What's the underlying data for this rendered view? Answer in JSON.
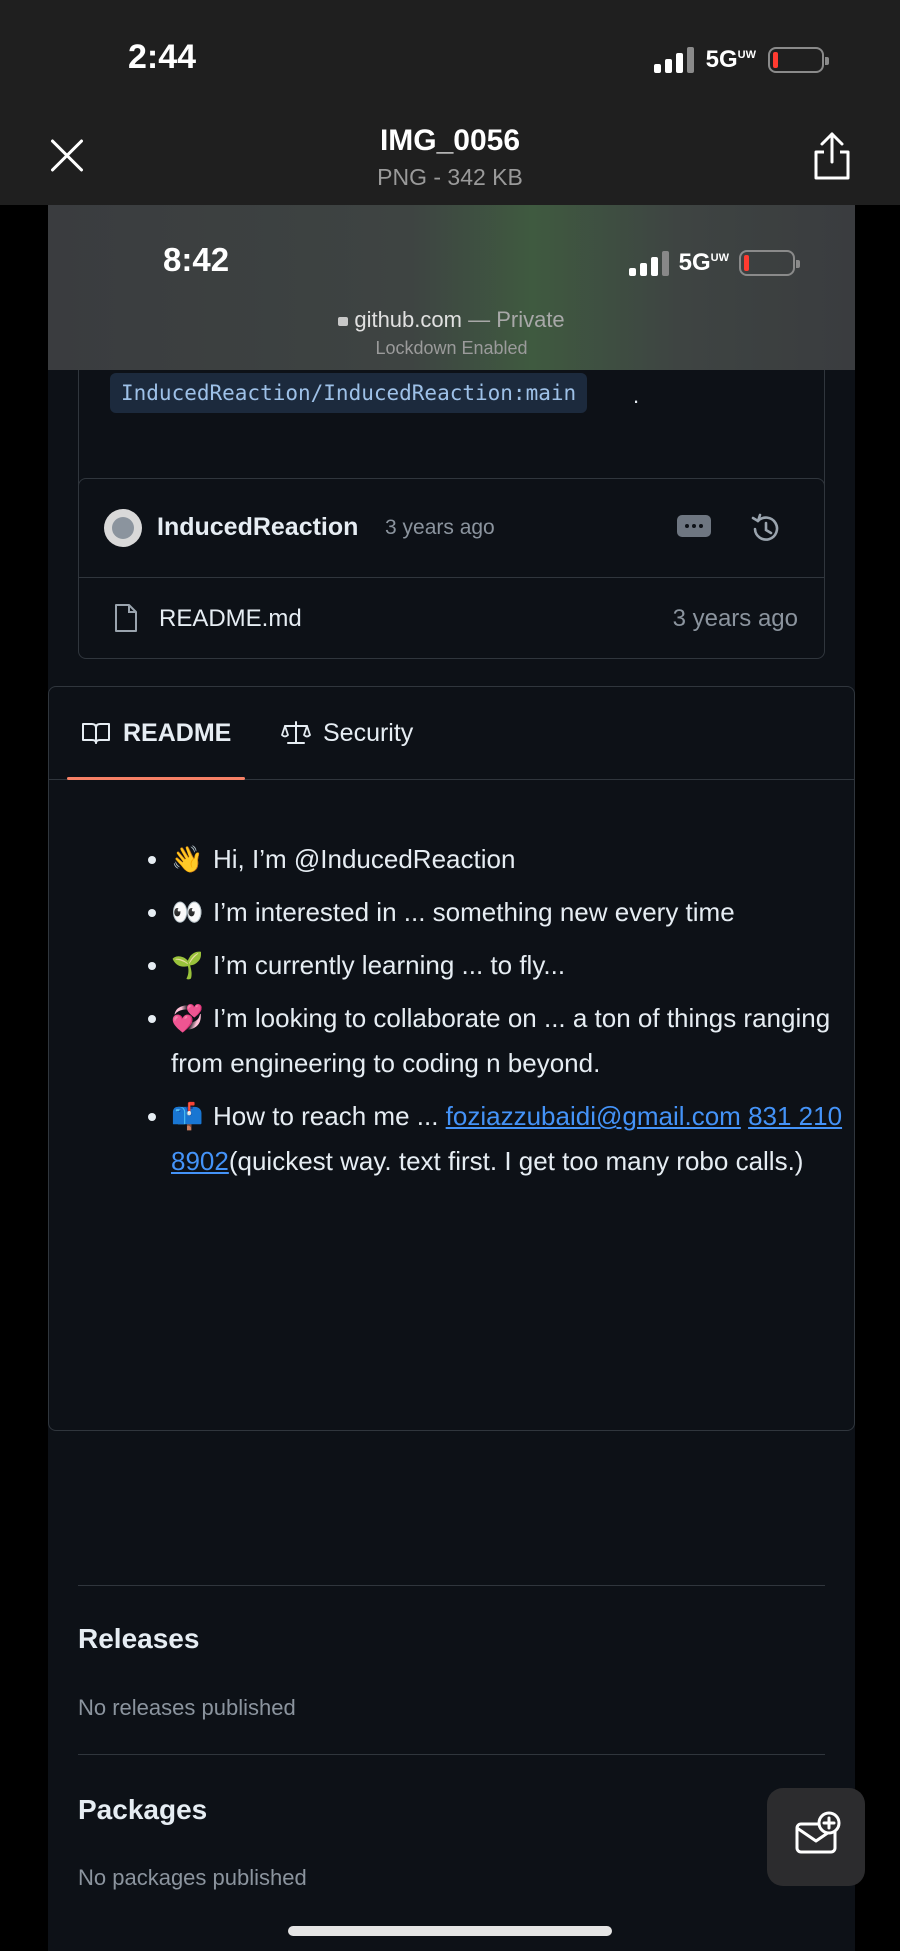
{
  "viewer": {
    "status_time": "2:44",
    "network": "5G",
    "network_suffix": "UW",
    "file_name": "IMG_0056",
    "file_meta": "PNG - 342 KB"
  },
  "inner_status": {
    "time": "8:42",
    "network": "5G",
    "network_suffix": "UW",
    "url": "github.com",
    "url_privacy": "— Private",
    "lockdown": "Lockdown Enabled"
  },
  "repo": {
    "branch_ref": "InducedReaction/InducedReaction:main",
    "branch_suffix": ".",
    "commit": {
      "author": "InducedReaction",
      "time": "3 years ago"
    },
    "file": {
      "name": "README.md",
      "time": "3 years ago"
    }
  },
  "readme": {
    "tabs": [
      "README",
      "Security"
    ],
    "items": [
      {
        "emoji": "👋",
        "text": "Hi, I’m @InducedReaction"
      },
      {
        "emoji": "👀",
        "text": "I’m interested in ... something new every time"
      },
      {
        "emoji": "🌱",
        "text": "I’m currently learning ... to fly..."
      },
      {
        "emoji": "💞",
        "text": "I’m looking to collaborate on ... a ton of things ranging from engineering to coding n beyond."
      },
      {
        "emoji": "📫",
        "text": "How to reach me ...",
        "email": "foziazzubaidi@gmail.com",
        "phone": "831 210 8902",
        "tail": "(quickest way. text first. I get too many robo calls.)"
      }
    ]
  },
  "sidebar": {
    "releases_title": "Releases",
    "releases_text": "No releases published",
    "packages_title": "Packages",
    "packages_text": "No packages published"
  },
  "colors": {
    "accent_tab": "#f78166",
    "link": "#4493f8",
    "battery_low": "#ff3b30"
  }
}
